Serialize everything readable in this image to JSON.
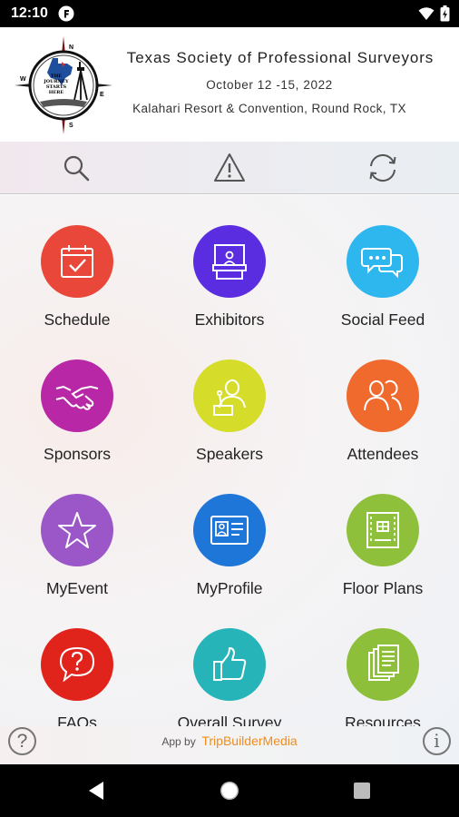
{
  "status": {
    "time": "12:10"
  },
  "header": {
    "title": "Texas Society of Professional Surveyors",
    "dates": "October 12 -15, 2022",
    "venue": "Kalahari Resort & Convention, Round Rock, TX",
    "logo_text": [
      "THE",
      "JOURNEY",
      "STARTS",
      "HERE"
    ],
    "compass": {
      "n": "N",
      "s": "S",
      "e": "E",
      "w": "W"
    }
  },
  "toolbar": {
    "search": "search-icon",
    "alerts": "warning-icon",
    "sync": "refresh-icon"
  },
  "tiles": [
    {
      "label": "Schedule",
      "color": "#e8473a",
      "icon": "calendar-check-icon"
    },
    {
      "label": "Exhibitors",
      "color": "#5b2de0",
      "icon": "booth-icon"
    },
    {
      "label": "Social Feed",
      "color": "#2eb6ef",
      "icon": "chat-bubbles-icon"
    },
    {
      "label": "Sponsors",
      "color": "#b827a6",
      "icon": "handshake-icon"
    },
    {
      "label": "Speakers",
      "color": "#d5dc2a",
      "icon": "speaker-podium-icon"
    },
    {
      "label": "Attendees",
      "color": "#f06a2e",
      "icon": "people-icon"
    },
    {
      "label": "MyEvent",
      "color": "#9b56c7",
      "icon": "star-icon"
    },
    {
      "label": "MyProfile",
      "color": "#1d76d8",
      "icon": "id-card-icon"
    },
    {
      "label": "Floor Plans",
      "color": "#8fc03c",
      "icon": "floor-plan-icon"
    },
    {
      "label": "FAQs",
      "color": "#e0231b",
      "icon": "question-bubble-icon"
    },
    {
      "label": "Overall Survey",
      "color": "#27b4b8",
      "icon": "thumbs-up-icon"
    },
    {
      "label": "Resources",
      "color": "#8dbf3b",
      "icon": "documents-icon"
    }
  ],
  "footer": {
    "prefix": "App by",
    "brand_a": "TripBuilder",
    "brand_b": "Media",
    "help": "?",
    "info": "i"
  }
}
